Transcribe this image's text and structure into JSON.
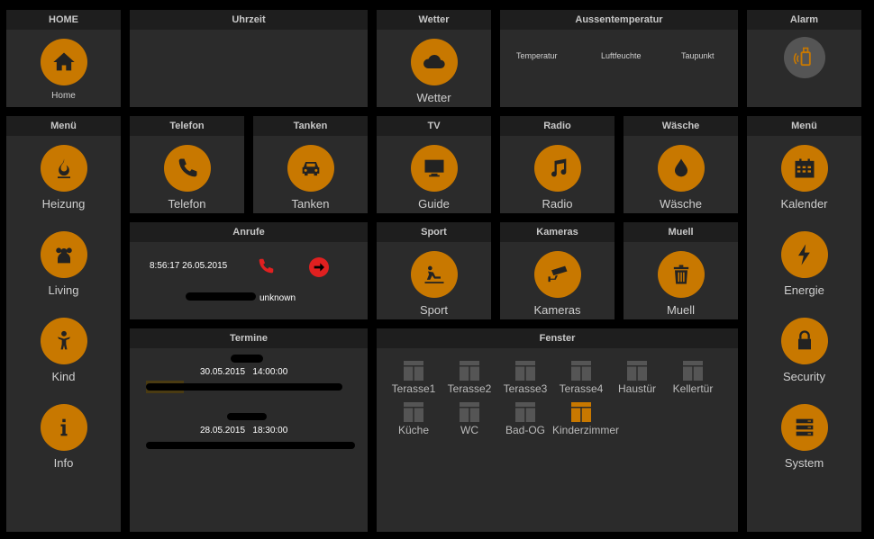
{
  "panels": {
    "home": {
      "title": "HOME",
      "label": "Home"
    },
    "uhrzeit": {
      "title": "Uhrzeit"
    },
    "wetter": {
      "title": "Wetter",
      "label": "Wetter"
    },
    "aussen": {
      "title": "Aussentemperatur",
      "temp": "Temperatur",
      "feuchte": "Luftfeuchte",
      "taupunkt": "Taupunkt"
    },
    "alarm": {
      "title": "Alarm"
    },
    "menu_left": {
      "title": "Menü",
      "items": [
        "Heizung",
        "Living",
        "Kind",
        "Info"
      ]
    },
    "telefon": {
      "title": "Telefon",
      "label": "Telefon"
    },
    "tanken": {
      "title": "Tanken",
      "label": "Tanken"
    },
    "tv": {
      "title": "TV",
      "label": "Guide"
    },
    "radio": {
      "title": "Radio",
      "label": "Radio"
    },
    "waesche": {
      "title": "Wäsche",
      "label": "Wäsche"
    },
    "menu_right": {
      "title": "Menü",
      "items": [
        "Kalender",
        "Energie",
        "Security",
        "System"
      ]
    },
    "anrufe": {
      "title": "Anrufe",
      "time": "8:56:17 26.05.2015",
      "caller": "unknown"
    },
    "sport": {
      "title": "Sport",
      "label": "Sport"
    },
    "kameras": {
      "title": "Kameras",
      "label": "Kameras"
    },
    "muell": {
      "title": "Muell",
      "label": "Muell"
    },
    "termine": {
      "title": "Termine",
      "entries": [
        {
          "date": "30.05.2015   14:00:00"
        },
        {
          "date": "28.05.2015   18:30:00"
        }
      ]
    },
    "fenster": {
      "title": "Fenster",
      "windows": [
        {
          "name": "Terasse1",
          "open": false
        },
        {
          "name": "Terasse2",
          "open": false
        },
        {
          "name": "Terasse3",
          "open": false
        },
        {
          "name": "Terasse4",
          "open": false
        },
        {
          "name": "Haustür",
          "open": false
        },
        {
          "name": "Kellertür",
          "open": false
        },
        {
          "name": "Küche",
          "open": false
        },
        {
          "name": "WC",
          "open": false
        },
        {
          "name": "Bad-OG",
          "open": false
        },
        {
          "name": "Kinderzimmer",
          "open": true
        }
      ]
    }
  },
  "colors": {
    "accent": "#c87800",
    "panel": "#2b2b2b",
    "header": "#1e1e1e",
    "alarm_red": "#e02020"
  }
}
